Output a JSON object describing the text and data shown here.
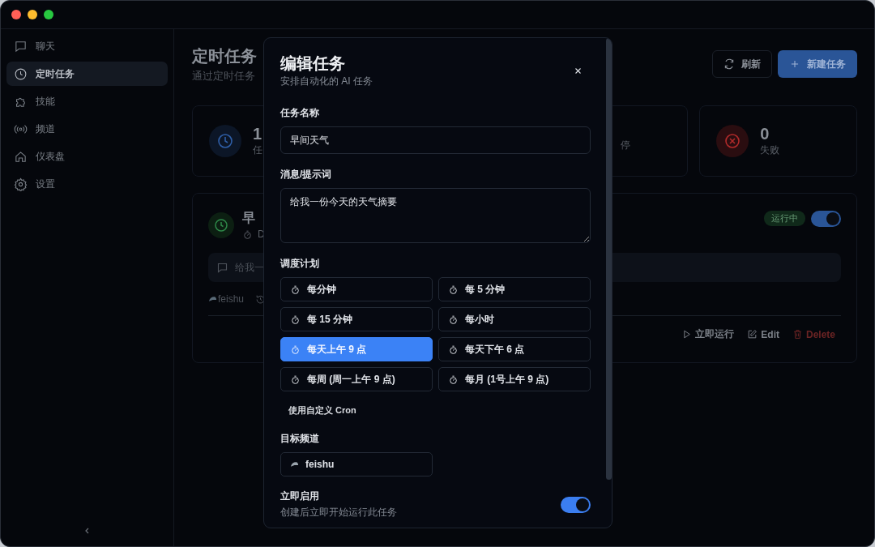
{
  "sidebar": {
    "items": [
      {
        "label": "聊天",
        "selected": false
      },
      {
        "label": "定时任务",
        "selected": true
      },
      {
        "label": "技能",
        "selected": false
      },
      {
        "label": "频道",
        "selected": false
      },
      {
        "label": "仪表盘",
        "selected": false
      },
      {
        "label": "设置",
        "selected": false
      }
    ]
  },
  "header": {
    "title": "定时任务",
    "subtitle": "通过定时任务",
    "buttons": [
      {
        "kind": "refresh",
        "label": "刷新"
      },
      {
        "kind": "new",
        "label": "新建任务"
      }
    ]
  },
  "stats": [
    {
      "kind": "total",
      "value": "1",
      "label": "任"
    },
    {
      "kind": "paused",
      "label": "停"
    },
    {
      "kind": "failed",
      "value": "0",
      "label": "失败"
    }
  ],
  "task": {
    "title": "早",
    "schedule": "D",
    "status": "运行中",
    "enabled": true,
    "message": "给我一",
    "channel": "feishu",
    "actions": [
      {
        "kind": "run",
        "label": "立即运行"
      },
      {
        "kind": "edit",
        "label": "Edit"
      },
      {
        "kind": "delete",
        "label": "Delete"
      }
    ]
  },
  "modal": {
    "title": "编辑任务",
    "subtitle": "安排自动化的 AI 任务",
    "name": {
      "label": "任务名称",
      "value": "早间天气"
    },
    "message": {
      "label": "消息/提示词",
      "value": "给我一份今天的天气摘要"
    },
    "schedule": {
      "label": "调度计划",
      "options": [
        {
          "label": "每分钟",
          "selected": false
        },
        {
          "label": "每 5 分钟",
          "selected": false
        },
        {
          "label": "每 15 分钟",
          "selected": false
        },
        {
          "label": "每小时",
          "selected": false
        },
        {
          "label": "每天上午 9 点",
          "selected": true
        },
        {
          "label": "每天下午 6 点",
          "selected": false
        },
        {
          "label": "每周 (周一上午 9 点)",
          "selected": false
        },
        {
          "label": "每月 (1号上午 9 点)",
          "selected": false
        }
      ],
      "custom": "使用自定义 Cron"
    },
    "channel": {
      "label": "目标频道",
      "options": [
        {
          "label": "feishu"
        }
      ]
    },
    "enable": {
      "label": "立即启用",
      "description": "创建后立即开始运行此任务",
      "on": true
    }
  }
}
